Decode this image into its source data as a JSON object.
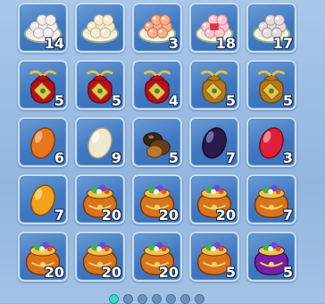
{
  "inventory": {
    "slots": [
      {
        "item": "rice-ball-plate-icon",
        "variant": "white",
        "count": "14"
      },
      {
        "item": "rice-ball-plate-icon",
        "variant": "cream",
        "count": ""
      },
      {
        "item": "rice-ball-plate-icon",
        "variant": "orange",
        "count": "3"
      },
      {
        "item": "rice-ball-plate-icon",
        "variant": "pink",
        "count": "18"
      },
      {
        "item": "rice-ball-plate-icon",
        "variant": "grey",
        "count": "17"
      },
      {
        "item": "lucky-bag-icon",
        "variant": "red",
        "count": "5"
      },
      {
        "item": "lucky-bag-icon",
        "variant": "red",
        "count": "5"
      },
      {
        "item": "lucky-bag-icon",
        "variant": "red",
        "count": "4"
      },
      {
        "item": "lucky-bag-icon",
        "variant": "gold",
        "count": "5"
      },
      {
        "item": "lucky-bag-icon",
        "variant": "gold",
        "count": "5"
      },
      {
        "item": "orange-gem-icon",
        "variant": "orange",
        "count": "6"
      },
      {
        "item": "white-gem-icon",
        "variant": "white",
        "count": "9"
      },
      {
        "item": "brown-stones-icon",
        "variant": "brown",
        "count": "5"
      },
      {
        "item": "dark-purple-gem-icon",
        "variant": "purple",
        "count": "7"
      },
      {
        "item": "red-gem-icon",
        "variant": "red",
        "count": "3"
      },
      {
        "item": "amber-gem-icon",
        "variant": "amber",
        "count": "7"
      },
      {
        "item": "treasure-pouch-icon",
        "variant": "orange",
        "count": "20"
      },
      {
        "item": "treasure-pouch-icon",
        "variant": "orange",
        "count": "20"
      },
      {
        "item": "treasure-pouch-icon",
        "variant": "orange",
        "count": "20"
      },
      {
        "item": "treasure-pouch-icon",
        "variant": "orange",
        "count": "7"
      },
      {
        "item": "treasure-pouch-icon",
        "variant": "orange",
        "count": "20"
      },
      {
        "item": "treasure-pouch-icon",
        "variant": "orange",
        "count": "20"
      },
      {
        "item": "treasure-pouch-icon",
        "variant": "orange",
        "count": "20"
      },
      {
        "item": "treasure-pouch-icon",
        "variant": "orange",
        "count": "5"
      },
      {
        "item": "purple-pouch-icon",
        "variant": "purple",
        "count": "5"
      }
    ]
  },
  "pager": {
    "pages": 7,
    "current": 1
  },
  "colors": {
    "slot_blue": "#3f78c2",
    "count_text": "#ffffff",
    "pager_active": "#3fd6c6"
  }
}
